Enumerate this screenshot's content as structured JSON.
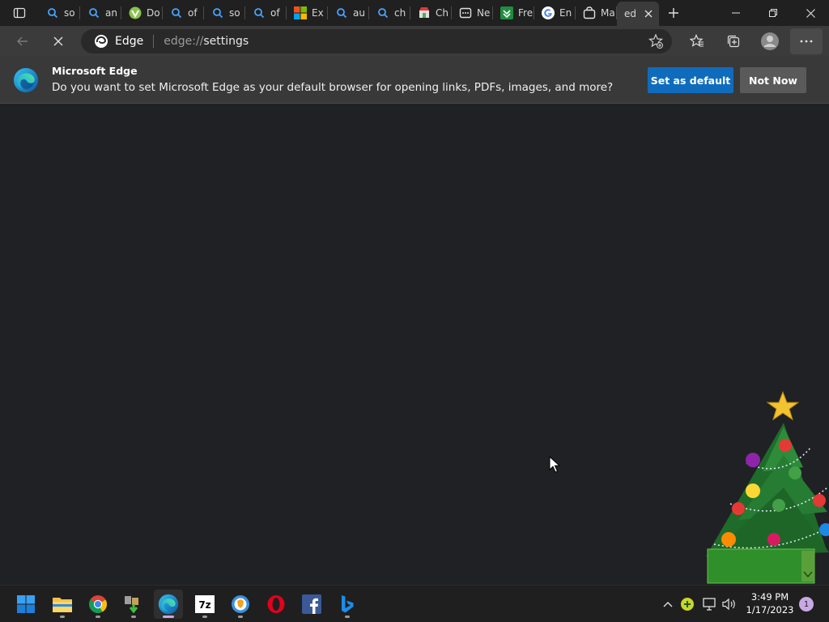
{
  "tabs": [
    {
      "icon": "search-icon",
      "title": "so"
    },
    {
      "icon": "search-icon",
      "title": "an"
    },
    {
      "icon": "site-logo-icon",
      "title": "Do"
    },
    {
      "icon": "search-icon",
      "title": "of"
    },
    {
      "icon": "search-icon",
      "title": "so"
    },
    {
      "icon": "search-icon",
      "title": "of"
    },
    {
      "icon": "microsoft-logo-icon",
      "title": "Ex"
    },
    {
      "icon": "search-icon",
      "title": "au"
    },
    {
      "icon": "search-icon",
      "title": "ch"
    },
    {
      "icon": "store-icon",
      "title": "Ch"
    },
    {
      "icon": "calendar-icon",
      "title": "Ne"
    },
    {
      "icon": "green-app-icon",
      "title": "Fre"
    },
    {
      "icon": "google-icon",
      "title": "En"
    },
    {
      "icon": "bag-icon",
      "title": "Ma"
    },
    {
      "icon": "none",
      "title": "ed"
    }
  ],
  "address": {
    "site_label": "Edge",
    "url_prefix": "edge://",
    "url_path": "settings"
  },
  "infobar": {
    "title": "Microsoft Edge",
    "message": "Do you want to set Microsoft Edge as your default browser for opening links, PDFs, images, and more?",
    "primary_button": "Set as default",
    "secondary_button": "Not Now"
  },
  "taskbar": {
    "apps": [
      "start-icon",
      "file-explorer-icon",
      "chrome-icon",
      "download-app-icon",
      "edge-icon",
      "7zip-icon",
      "brave-icon",
      "opera-icon",
      "facebook-icon",
      "bing-icon"
    ],
    "time": "3:49 PM",
    "date": "1/17/2023",
    "notifications": "1"
  },
  "colors": {
    "accent": "#0f6cbd",
    "background": "#202124",
    "toolbar": "#3b3b3b"
  }
}
